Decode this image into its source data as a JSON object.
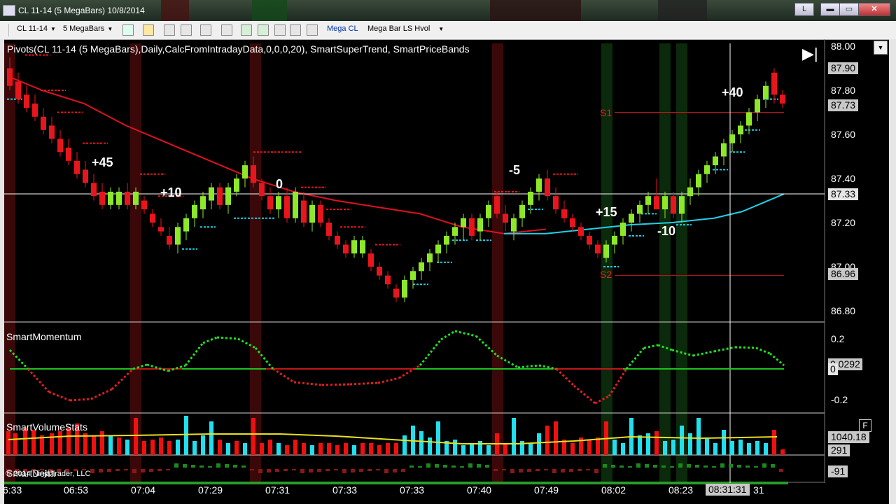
{
  "window": {
    "title": "CL 11-14 (5 MegaBars)  10/8/2014",
    "controls": {
      "l": "L",
      "min": "▬",
      "max": "▭",
      "close": "✕"
    }
  },
  "toolbar": {
    "instrument": "CL 11-14",
    "interval": "5 MegaBars",
    "template": "Mega CL",
    "workspace": "Mega Bar LS Hvol"
  },
  "price_panel": {
    "indicator_text": "Pivots(CL 11-14 (5 MegaBars),Daily,CalcFromIntradayData,0,0,0,20), SmartSuperTrend, SmartPriceBands",
    "axis_ticks": [
      "88.00",
      "87.80",
      "87.60",
      "87.40",
      "87.20",
      "87.00",
      "86.80"
    ],
    "tags": {
      "t1": "87.90",
      "t2": "87.73",
      "t3": "87.33",
      "t4": "86.96"
    },
    "pivots": {
      "s1": "S1",
      "s2": "S2"
    },
    "trade_labels": [
      "+45",
      "+10",
      "0",
      "-5",
      "+15",
      "-10",
      "+40"
    ]
  },
  "momentum_panel": {
    "label": "SmartMomentum",
    "axis_ticks": [
      "0.2",
      "-0.2"
    ],
    "tag_a": "0",
    "tag_b": "0.0292"
  },
  "volume_panel": {
    "label": "SmartVolumeStats",
    "tag_a": "1040.18",
    "tag_b": "291",
    "f_box": "F"
  },
  "delta_panel": {
    "label": "SmartDelta",
    "tag": "-91"
  },
  "copyright": "© 2014 NinjaTrader, LLC",
  "time_axis": {
    "labels": [
      "6:33",
      "06:53",
      "07:04",
      "07:29",
      "07:31",
      "07:33",
      "07:33",
      "07:40",
      "07:49",
      "08:02",
      "08:23"
    ],
    "cursor_time": "08:31:31",
    "trailing": "31"
  },
  "colors": {
    "up_candle": "#8ee82a",
    "down_candle": "#e8161c",
    "ma_line": "#e01020",
    "band_line": "#20d0e8",
    "momentum_up": "#20e020",
    "momentum_down": "#e02020",
    "volume_up": "#20e0f0",
    "volume_down": "#f01010",
    "volume_avg": "#e8e020"
  }
}
